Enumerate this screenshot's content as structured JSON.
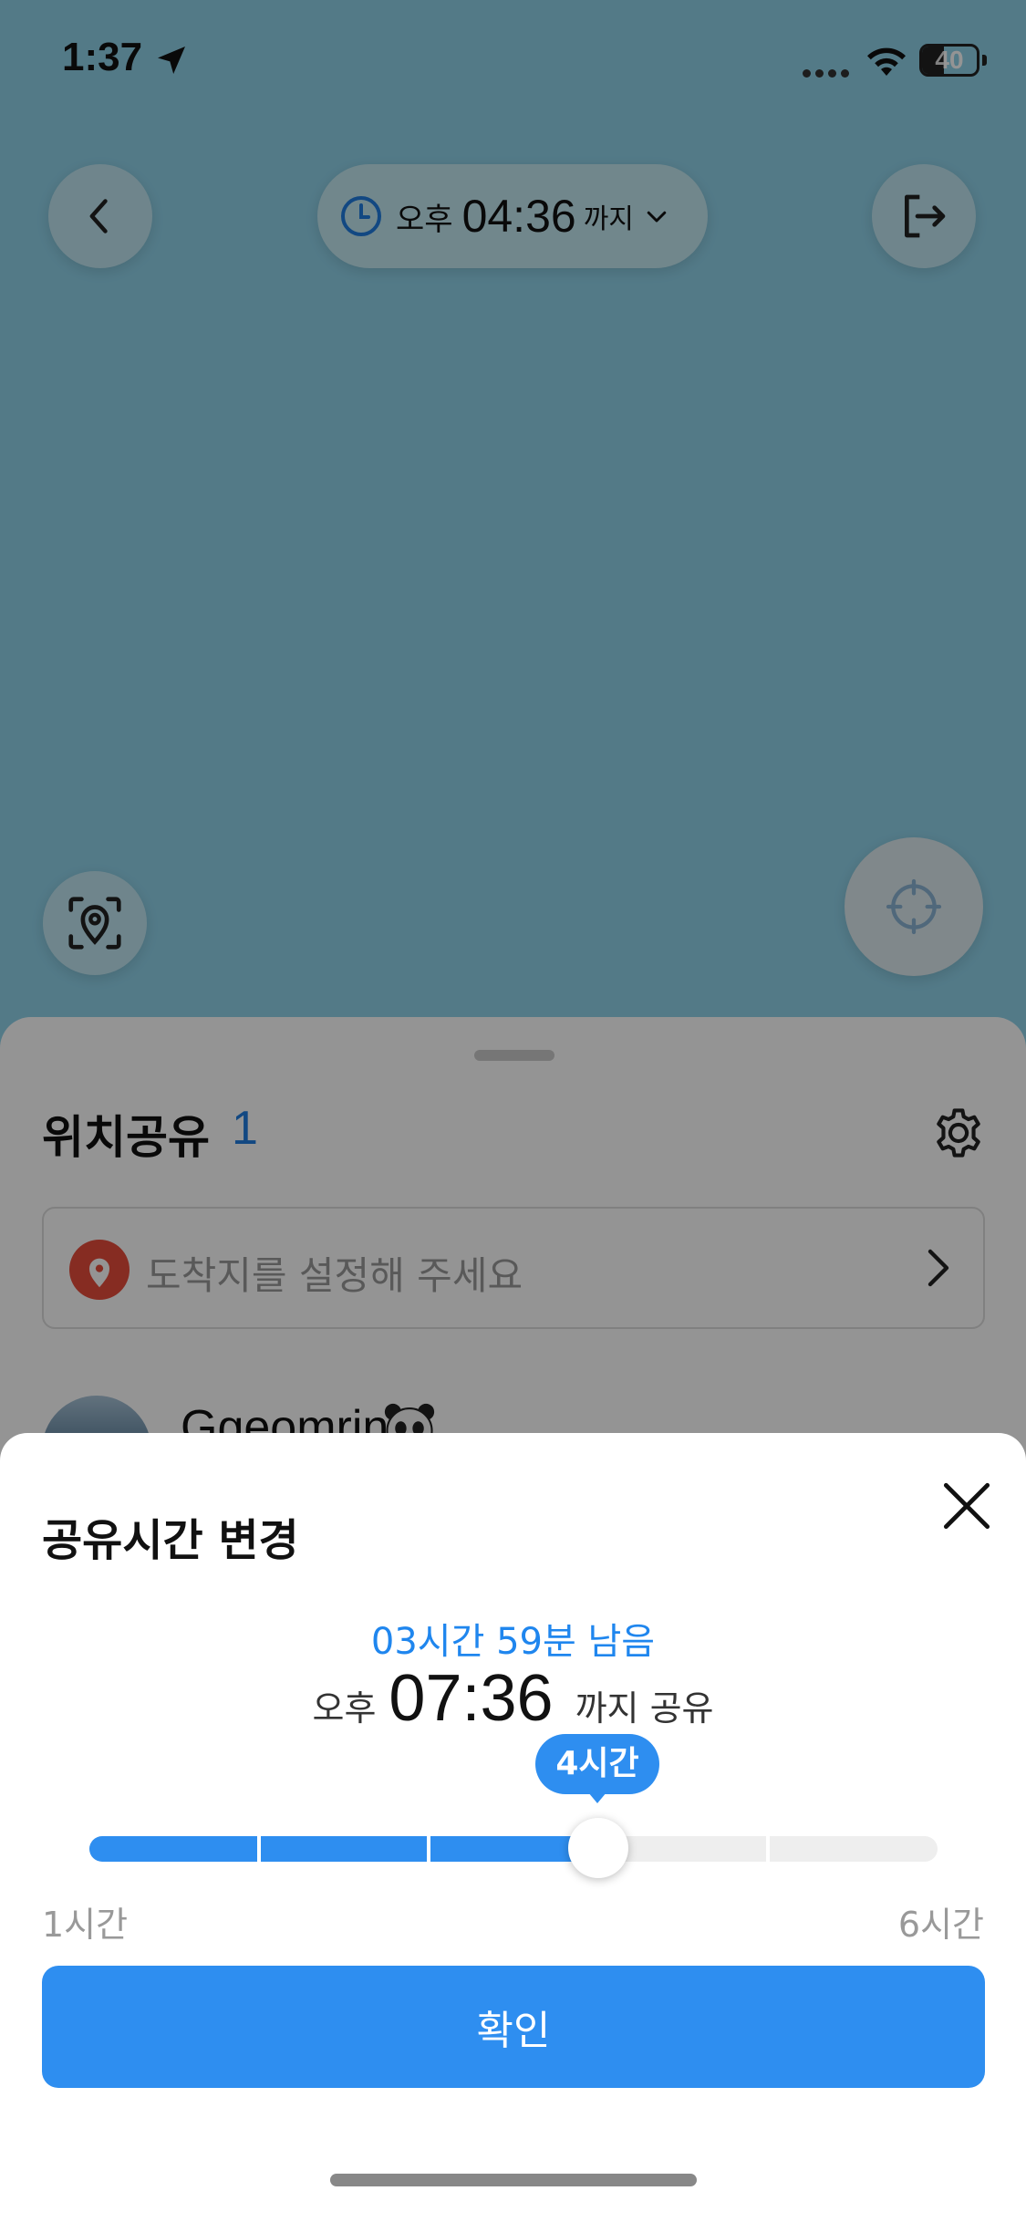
{
  "status_bar": {
    "time": "1:37",
    "battery": "40",
    "battery_level": 0.4
  },
  "map": {
    "share_until_pill": {
      "ampm": "오후",
      "time": "04:36",
      "suffix": "까지"
    },
    "icons": {
      "back": "chevron-left-icon",
      "exit": "exit-icon",
      "gps": "location-scan-icon",
      "target": "crosshair-icon"
    }
  },
  "share_sheet": {
    "title": "위치공유",
    "count": "1",
    "destination_placeholder": "도착지를 설정해 주세요",
    "member": {
      "name": "Ggeomrin"
    }
  },
  "modal": {
    "title": "공유시간 변경",
    "remaining": "03시간 59분 남음",
    "until": {
      "ampm": "오후",
      "time": "07:36",
      "suffix": "까지 공유"
    },
    "slider": {
      "tooltip": "4시간",
      "min_label": "1시간",
      "max_label": "6시간",
      "value_hours": 4,
      "min_hours": 1,
      "max_hours": 6,
      "fill_fraction": 0.6
    },
    "confirm_label": "확인"
  },
  "colors": {
    "accent": "#2e8ef0",
    "map_water": "#8fd2e9",
    "destination_pin": "#e74c3c"
  }
}
